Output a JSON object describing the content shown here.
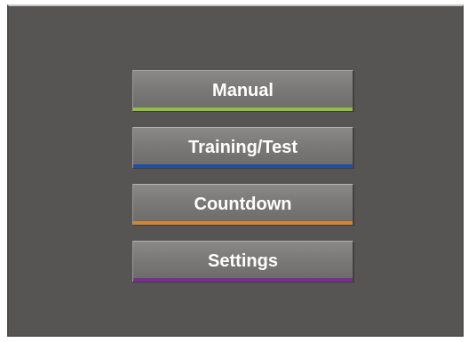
{
  "menu": {
    "items": [
      {
        "label": "Manual",
        "accent_color": "#8fbf3f"
      },
      {
        "label": "Training/Test",
        "accent_color": "#1f4fa3"
      },
      {
        "label": "Countdown",
        "accent_color": "#d9842a"
      },
      {
        "label": "Settings",
        "accent_color": "#7a2f8f"
      }
    ]
  }
}
